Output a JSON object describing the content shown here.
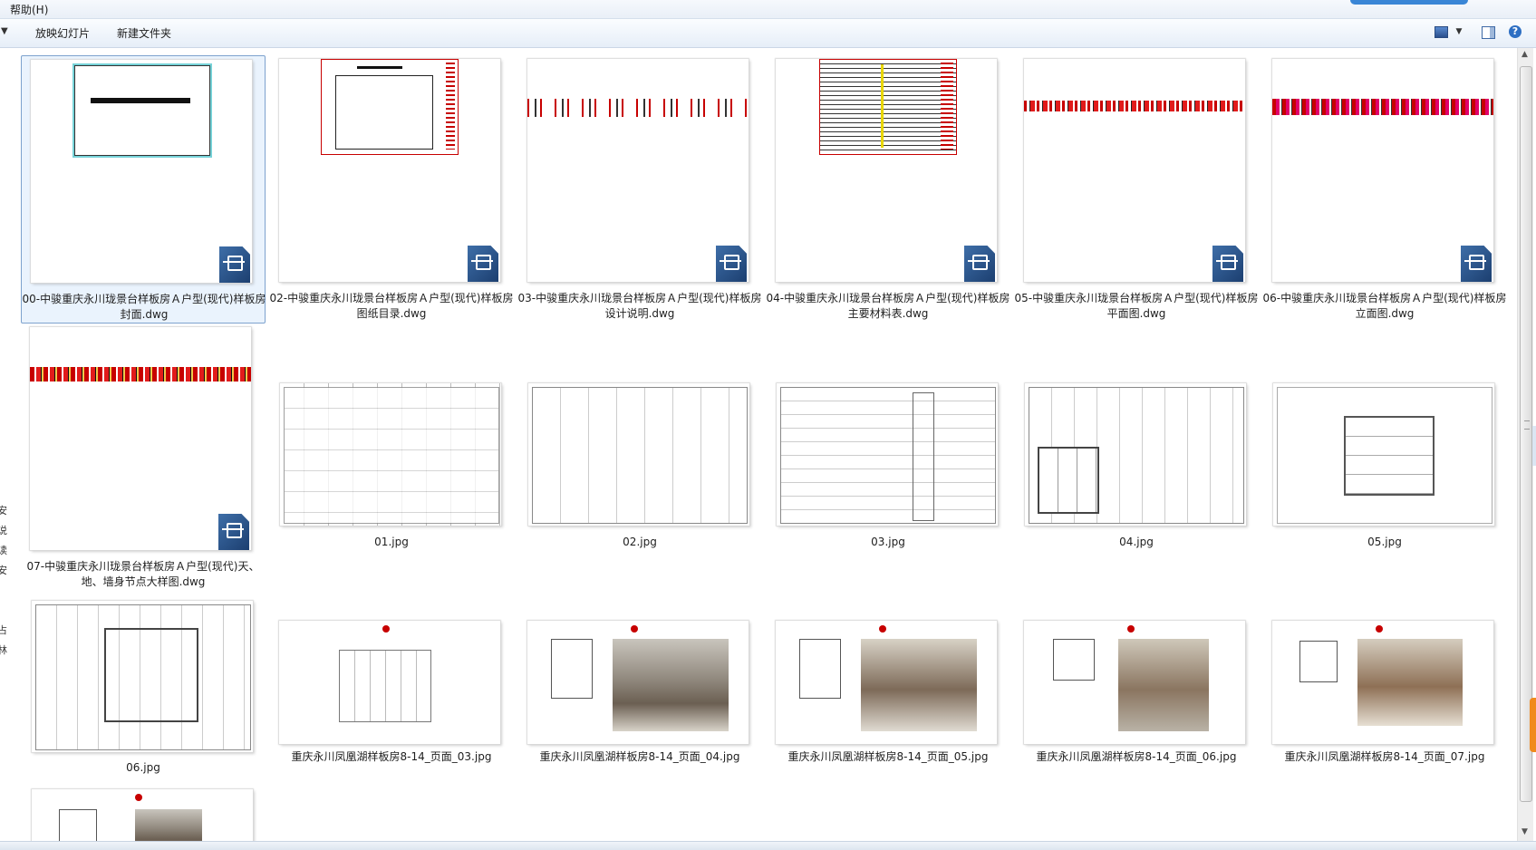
{
  "menubar": {
    "help_label": "帮助(H)"
  },
  "toolbar": {
    "slideshow_label": "放映幻灯片",
    "new_folder_label": "新建文件夹",
    "views_icon": "views-icon",
    "preview_pane_icon": "preview-pane-icon",
    "help_icon": "help-icon"
  },
  "left_edge_chars": [
    "安",
    "说",
    "读",
    "安",
    "占",
    "林"
  ],
  "files": [
    {
      "name": "00-中骏重庆永川珑景台样板房Ａ户型(现代)样板房封面.dwg",
      "type": "dwg",
      "selected": true
    },
    {
      "name": "02-中骏重庆永川珑景台样板房Ａ户型(现代)样板房图纸目录.dwg",
      "type": "dwg"
    },
    {
      "name": "03-中骏重庆永川珑景台样板房Ａ户型(现代)样板房设计说明.dwg",
      "type": "dwg"
    },
    {
      "name": "04-中骏重庆永川珑景台样板房Ａ户型(现代)样板房主要材料表.dwg",
      "type": "dwg"
    },
    {
      "name": "05-中骏重庆永川珑景台样板房Ａ户型(现代)样板房平面图.dwg",
      "type": "dwg"
    },
    {
      "name": "06-中骏重庆永川珑景台样板房Ａ户型(现代)样板房立面图.dwg",
      "type": "dwg"
    },
    {
      "name": "07-中骏重庆永川珑景台样板房Ａ户型(现代)天、地、墙身节点大样图.dwg",
      "type": "dwg"
    },
    {
      "name": "01.jpg",
      "type": "jpg"
    },
    {
      "name": "02.jpg",
      "type": "jpg"
    },
    {
      "name": "03.jpg",
      "type": "jpg"
    },
    {
      "name": "04.jpg",
      "type": "jpg"
    },
    {
      "name": "05.jpg",
      "type": "jpg"
    },
    {
      "name": "06.jpg",
      "type": "jpg"
    },
    {
      "name": "重庆永川凤凰湖样板房8-14_页面_03.jpg",
      "type": "jpg"
    },
    {
      "name": "重庆永川凤凰湖样板房8-14_页面_04.jpg",
      "type": "jpg"
    },
    {
      "name": "重庆永川凤凰湖样板房8-14_页面_05.jpg",
      "type": "jpg"
    },
    {
      "name": "重庆永川凤凰湖样板房8-14_页面_06.jpg",
      "type": "jpg"
    },
    {
      "name": "重庆永川凤凰湖样板房8-14_页面_07.jpg",
      "type": "jpg"
    }
  ],
  "colors": {
    "cad_red": "#c70000",
    "selection": "#eaf3fd",
    "accent": "#2e6fc3"
  }
}
